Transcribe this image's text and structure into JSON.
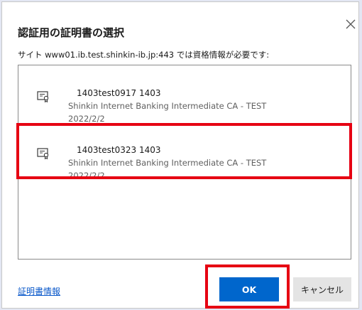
{
  "dialog": {
    "title": "認証用の証明書の選択",
    "subtitle": "サイト www01.ib.test.shinkin-ib.jp:443 では資格情報が必要です:",
    "close_icon": "close-icon"
  },
  "certificates": [
    {
      "name": "1403test0917 1403",
      "issuer": "Shinkin Internet Banking Intermediate CA - TEST",
      "date": "2022/2/2",
      "icon": "certificate-icon"
    },
    {
      "name": "1403test0323 1403",
      "issuer": "Shinkin Internet Banking Intermediate CA - TEST",
      "date": "2022/2/2",
      "icon": "certificate-icon"
    }
  ],
  "footer": {
    "cert_info_link": "証明書情報",
    "ok_label": "OK",
    "cancel_label": "キャンセル"
  },
  "colors": {
    "accent": "#0066cc",
    "highlight": "#e60012",
    "background": "#e3e6f3"
  }
}
